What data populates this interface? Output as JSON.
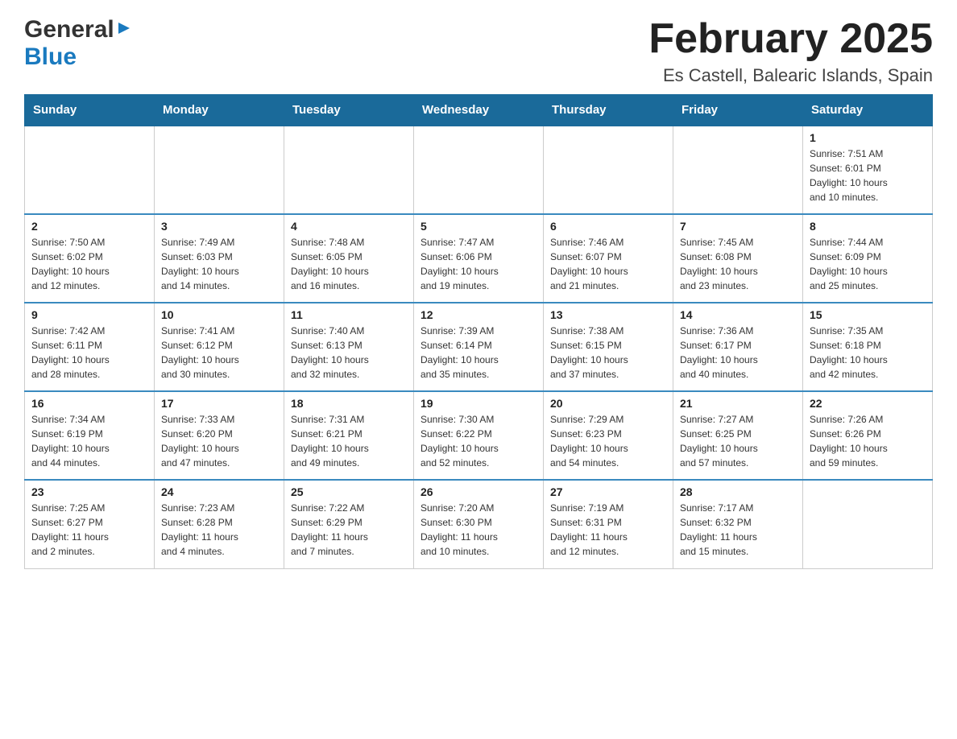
{
  "header": {
    "logo_general": "General",
    "logo_blue": "Blue",
    "title": "February 2025",
    "subtitle": "Es Castell, Balearic Islands, Spain"
  },
  "days_of_week": [
    "Sunday",
    "Monday",
    "Tuesday",
    "Wednesday",
    "Thursday",
    "Friday",
    "Saturday"
  ],
  "weeks": [
    [
      {
        "day": "",
        "info": ""
      },
      {
        "day": "",
        "info": ""
      },
      {
        "day": "",
        "info": ""
      },
      {
        "day": "",
        "info": ""
      },
      {
        "day": "",
        "info": ""
      },
      {
        "day": "",
        "info": ""
      },
      {
        "day": "1",
        "info": "Sunrise: 7:51 AM\nSunset: 6:01 PM\nDaylight: 10 hours\nand 10 minutes."
      }
    ],
    [
      {
        "day": "2",
        "info": "Sunrise: 7:50 AM\nSunset: 6:02 PM\nDaylight: 10 hours\nand 12 minutes."
      },
      {
        "day": "3",
        "info": "Sunrise: 7:49 AM\nSunset: 6:03 PM\nDaylight: 10 hours\nand 14 minutes."
      },
      {
        "day": "4",
        "info": "Sunrise: 7:48 AM\nSunset: 6:05 PM\nDaylight: 10 hours\nand 16 minutes."
      },
      {
        "day": "5",
        "info": "Sunrise: 7:47 AM\nSunset: 6:06 PM\nDaylight: 10 hours\nand 19 minutes."
      },
      {
        "day": "6",
        "info": "Sunrise: 7:46 AM\nSunset: 6:07 PM\nDaylight: 10 hours\nand 21 minutes."
      },
      {
        "day": "7",
        "info": "Sunrise: 7:45 AM\nSunset: 6:08 PM\nDaylight: 10 hours\nand 23 minutes."
      },
      {
        "day": "8",
        "info": "Sunrise: 7:44 AM\nSunset: 6:09 PM\nDaylight: 10 hours\nand 25 minutes."
      }
    ],
    [
      {
        "day": "9",
        "info": "Sunrise: 7:42 AM\nSunset: 6:11 PM\nDaylight: 10 hours\nand 28 minutes."
      },
      {
        "day": "10",
        "info": "Sunrise: 7:41 AM\nSunset: 6:12 PM\nDaylight: 10 hours\nand 30 minutes."
      },
      {
        "day": "11",
        "info": "Sunrise: 7:40 AM\nSunset: 6:13 PM\nDaylight: 10 hours\nand 32 minutes."
      },
      {
        "day": "12",
        "info": "Sunrise: 7:39 AM\nSunset: 6:14 PM\nDaylight: 10 hours\nand 35 minutes."
      },
      {
        "day": "13",
        "info": "Sunrise: 7:38 AM\nSunset: 6:15 PM\nDaylight: 10 hours\nand 37 minutes."
      },
      {
        "day": "14",
        "info": "Sunrise: 7:36 AM\nSunset: 6:17 PM\nDaylight: 10 hours\nand 40 minutes."
      },
      {
        "day": "15",
        "info": "Sunrise: 7:35 AM\nSunset: 6:18 PM\nDaylight: 10 hours\nand 42 minutes."
      }
    ],
    [
      {
        "day": "16",
        "info": "Sunrise: 7:34 AM\nSunset: 6:19 PM\nDaylight: 10 hours\nand 44 minutes."
      },
      {
        "day": "17",
        "info": "Sunrise: 7:33 AM\nSunset: 6:20 PM\nDaylight: 10 hours\nand 47 minutes."
      },
      {
        "day": "18",
        "info": "Sunrise: 7:31 AM\nSunset: 6:21 PM\nDaylight: 10 hours\nand 49 minutes."
      },
      {
        "day": "19",
        "info": "Sunrise: 7:30 AM\nSunset: 6:22 PM\nDaylight: 10 hours\nand 52 minutes."
      },
      {
        "day": "20",
        "info": "Sunrise: 7:29 AM\nSunset: 6:23 PM\nDaylight: 10 hours\nand 54 minutes."
      },
      {
        "day": "21",
        "info": "Sunrise: 7:27 AM\nSunset: 6:25 PM\nDaylight: 10 hours\nand 57 minutes."
      },
      {
        "day": "22",
        "info": "Sunrise: 7:26 AM\nSunset: 6:26 PM\nDaylight: 10 hours\nand 59 minutes."
      }
    ],
    [
      {
        "day": "23",
        "info": "Sunrise: 7:25 AM\nSunset: 6:27 PM\nDaylight: 11 hours\nand 2 minutes."
      },
      {
        "day": "24",
        "info": "Sunrise: 7:23 AM\nSunset: 6:28 PM\nDaylight: 11 hours\nand 4 minutes."
      },
      {
        "day": "25",
        "info": "Sunrise: 7:22 AM\nSunset: 6:29 PM\nDaylight: 11 hours\nand 7 minutes."
      },
      {
        "day": "26",
        "info": "Sunrise: 7:20 AM\nSunset: 6:30 PM\nDaylight: 11 hours\nand 10 minutes."
      },
      {
        "day": "27",
        "info": "Sunrise: 7:19 AM\nSunset: 6:31 PM\nDaylight: 11 hours\nand 12 minutes."
      },
      {
        "day": "28",
        "info": "Sunrise: 7:17 AM\nSunset: 6:32 PM\nDaylight: 11 hours\nand 15 minutes."
      },
      {
        "day": "",
        "info": ""
      }
    ]
  ]
}
